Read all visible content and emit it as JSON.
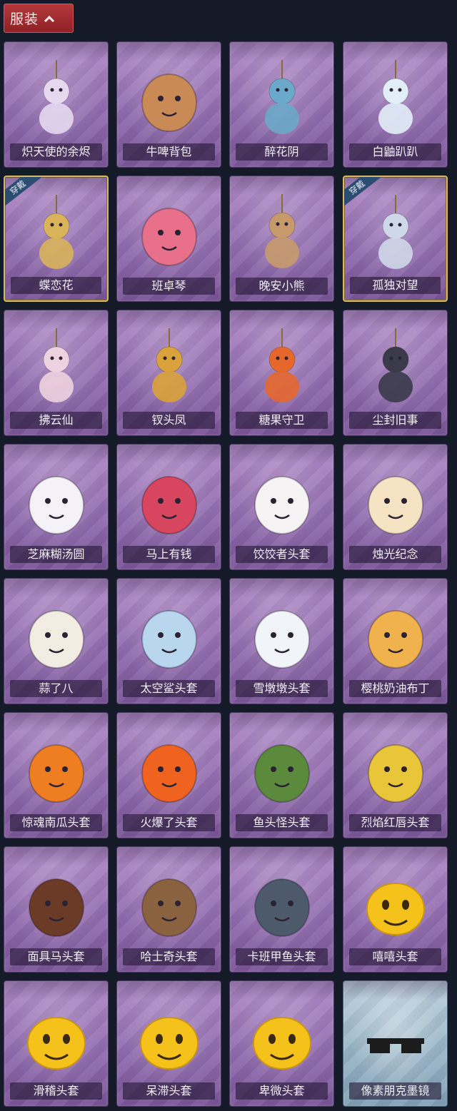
{
  "header": {
    "title": "服装"
  },
  "items": [
    {
      "name": "炽天使的余烬",
      "equipped": false,
      "icon": "angel-doll-icon",
      "color": "#e6d8ef"
    },
    {
      "name": "牛啤背包",
      "equipped": false,
      "icon": "cow-beer-barrel-icon",
      "color": "#c98a55"
    },
    {
      "name": "醉花阴",
      "equipped": false,
      "icon": "jeweled-dreamcatcher-icon",
      "color": "#6aa9c9"
    },
    {
      "name": "白鼬趴趴",
      "equipped": false,
      "icon": "white-ferret-icon",
      "color": "#e2eef8"
    },
    {
      "name": "蝶恋花",
      "equipped": true,
      "equipped_label": "穿戴",
      "icon": "bell-wreath-icon",
      "color": "#d8b35a"
    },
    {
      "name": "班卓琴",
      "equipped": false,
      "icon": "pink-creature-banjo-icon",
      "color": "#e8708a"
    },
    {
      "name": "晚安小熊",
      "equipped": false,
      "icon": "teddy-bear-icon",
      "color": "#c79a6b"
    },
    {
      "name": "孤独对望",
      "equipped": true,
      "equipped_label": "穿戴",
      "icon": "silver-haired-doll-icon",
      "color": "#cfd8e8"
    },
    {
      "name": "拂云仙",
      "equipped": false,
      "icon": "cloud-fairy-charm-icon",
      "color": "#efd2e0"
    },
    {
      "name": "钗头凤",
      "equipped": false,
      "icon": "phoenix-crown-doll-icon",
      "color": "#d9a23a"
    },
    {
      "name": "糖果守卫",
      "equipped": false,
      "icon": "pumpkin-scarecrow-icon",
      "color": "#e5672c"
    },
    {
      "name": "尘封旧事",
      "equipped": false,
      "icon": "crowned-boy-charm-icon",
      "color": "#3a3a4a"
    },
    {
      "name": "芝麻糊汤圆",
      "equipped": false,
      "icon": "rice-ball-head-icon",
      "color": "#f4f2f6"
    },
    {
      "name": "马上有钱",
      "equipped": false,
      "icon": "red-horse-head-icon",
      "color": "#d8455e"
    },
    {
      "name": "饺饺者头套",
      "equipped": false,
      "icon": "dumpling-cloud-head-icon",
      "color": "#f5f3f3"
    },
    {
      "name": "烛光纪念",
      "equipped": false,
      "icon": "candle-head-icon",
      "color": "#f6e3c4"
    },
    {
      "name": "蒜了八",
      "equipped": false,
      "icon": "garlic-head-icon",
      "color": "#f2ece2"
    },
    {
      "name": "太空鲨头套",
      "equipped": false,
      "icon": "shark-head-icon",
      "color": "#b9d6ef"
    },
    {
      "name": "雪墩墩头套",
      "equipped": false,
      "icon": "snowman-head-icon",
      "color": "#f1f4f8"
    },
    {
      "name": "樱桃奶油布丁",
      "equipped": false,
      "icon": "pudding-head-icon",
      "color": "#f0b24c"
    },
    {
      "name": "惊魂南瓜头套",
      "equipped": false,
      "icon": "jack-o-lantern-icon",
      "color": "#ef7d22"
    },
    {
      "name": "火爆了头套",
      "equipped": false,
      "icon": "fireball-head-icon",
      "color": "#f0621f"
    },
    {
      "name": "鱼头怪头套",
      "equipped": false,
      "icon": "fish-head-mask-icon",
      "color": "#5c8a3c"
    },
    {
      "name": "烈焰红唇头套",
      "equipped": false,
      "icon": "yellow-mascot-shades-icon",
      "color": "#e9c53a"
    },
    {
      "name": "面具马头套",
      "equipped": false,
      "icon": "horse-mask-icon",
      "color": "#6b3b27"
    },
    {
      "name": "哈士奇头套",
      "equipped": false,
      "icon": "husky-shades-icon",
      "color": "#8a6240"
    },
    {
      "name": "卡班甲鱼头套",
      "equipped": false,
      "icon": "blob-fish-head-icon",
      "color": "#4c5a6c"
    },
    {
      "name": "嘻嘻头套",
      "equipped": false,
      "icon": "grinning-emoji-icon",
      "color": "#f5c21c"
    },
    {
      "name": "滑稽头套",
      "equipped": false,
      "icon": "funny-emoji-icon",
      "color": "#f5c21c"
    },
    {
      "name": "呆滞头套",
      "equipped": false,
      "icon": "dazed-emoji-icon",
      "color": "#f5c21c"
    },
    {
      "name": "卑微头套",
      "equipped": false,
      "icon": "pleading-emoji-icon",
      "color": "#f5c21c"
    },
    {
      "name": "像素朋克墨镜",
      "equipped": false,
      "icon": "pixel-sunglasses-icon",
      "color": "#1c1c1c",
      "card": "blue"
    }
  ]
}
